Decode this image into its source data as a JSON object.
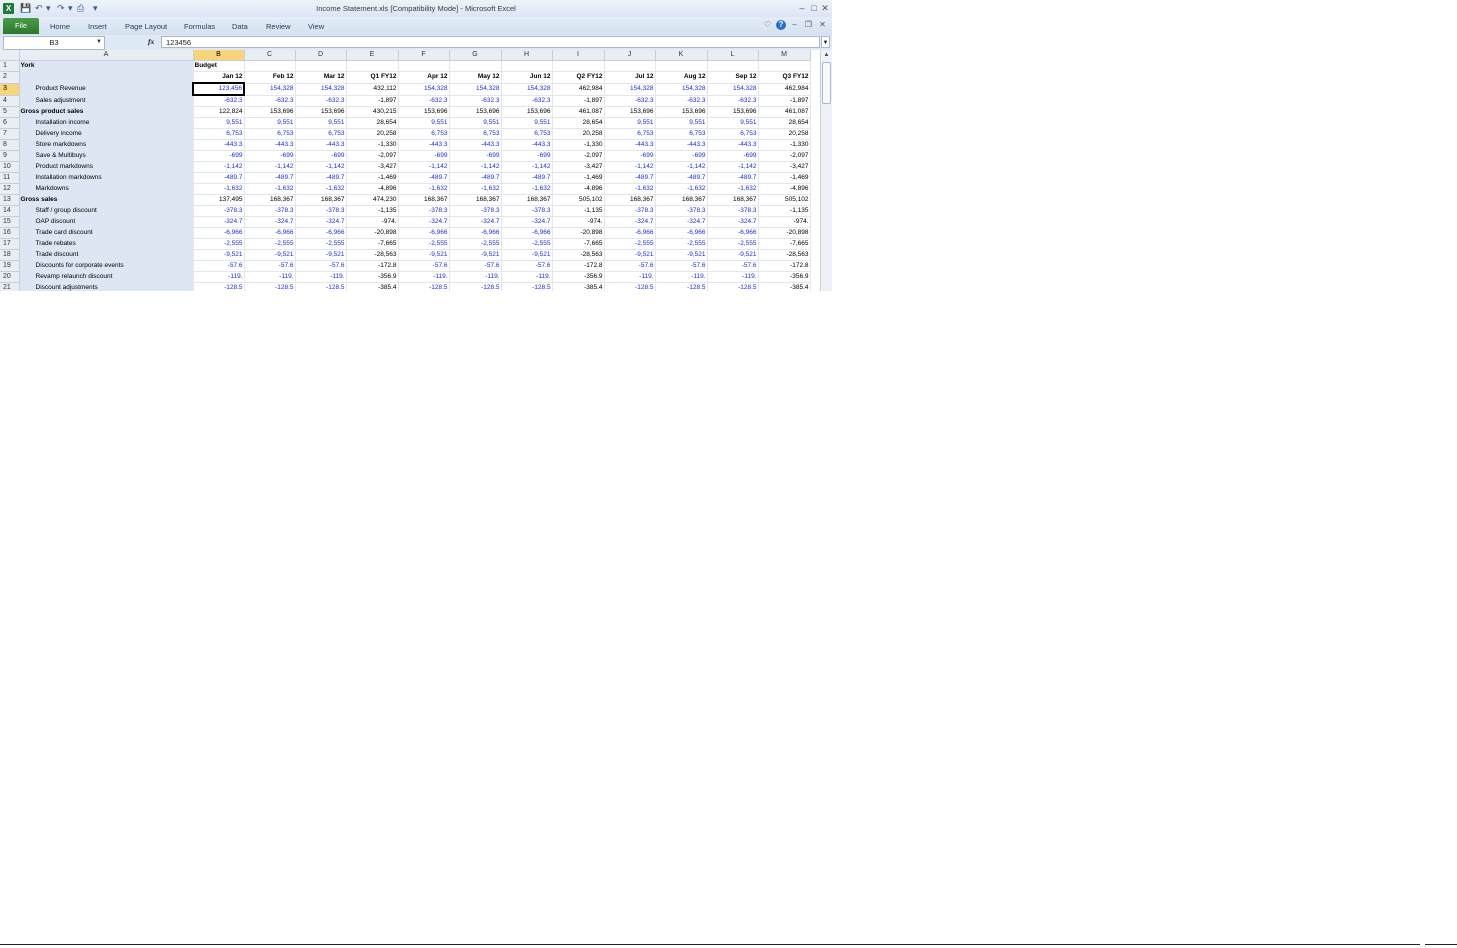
{
  "window": {
    "title": "Income Statement.xls  [Compatibility Mode]  -  Microsoft Excel",
    "app_icon": "excel-icon"
  },
  "ribbon": {
    "file_tab": "File",
    "tabs": [
      "Home",
      "Insert",
      "Page Layout",
      "Formulas",
      "Data",
      "Review",
      "View"
    ]
  },
  "formula_bar": {
    "name_box": "B3",
    "fx": "fx",
    "value": "123456"
  },
  "sheet": {
    "columns": [
      "A",
      "B",
      "C",
      "D",
      "E",
      "F",
      "G",
      "H",
      "I",
      "J",
      "K",
      "L",
      "M"
    ],
    "selected_column": "B",
    "rows": [
      {
        "n": "1",
        "label": "York",
        "style": "bold",
        "cells": [
          "Budget",
          "",
          "",
          "",
          "",
          "",
          "",
          "",
          "",
          "",
          "",
          ""
        ]
      },
      {
        "n": "2",
        "label": "",
        "style": "header",
        "cells": [
          "Jan 12",
          "Feb 12",
          "Mar 12",
          "Q1 FY12",
          "Apr 12",
          "May 12",
          "Jun 12",
          "Q2 FY12",
          "Jul 12",
          "Aug 12",
          "Sep 12",
          "Q3 FY12"
        ]
      },
      {
        "n": "3",
        "label": "Product Revenue",
        "style": "item",
        "cells": [
          "123,456",
          "154,328",
          "154,328",
          "432,112",
          "154,328",
          "154,328",
          "154,328",
          "462,984",
          "154,328",
          "154,328",
          "154,328",
          "462,984"
        ]
      },
      {
        "n": "4",
        "label": "Sales adjustment",
        "style": "item",
        "cells": [
          "-632.3",
          "-632.3",
          "-632.3",
          "-1,897",
          "-632.3",
          "-632.3",
          "-632.3",
          "-1,897",
          "-632.3",
          "-632.3",
          "-632.3",
          "-1,897"
        ]
      },
      {
        "n": "5",
        "label": "Gross product sales",
        "style": "total",
        "cells": [
          "122,824",
          "153,696",
          "153,696",
          "430,215",
          "153,696",
          "153,696",
          "153,696",
          "461,087",
          "153,696",
          "153,696",
          "153,696",
          "461,087"
        ]
      },
      {
        "n": "6",
        "label": "Installation income",
        "style": "item",
        "cells": [
          "9,551",
          "9,551",
          "9,551",
          "28,654",
          "9,551",
          "9,551",
          "9,551",
          "28,654",
          "9,551",
          "9,551",
          "9,551",
          "28,654"
        ]
      },
      {
        "n": "7",
        "label": "Delivery income",
        "style": "item",
        "cells": [
          "6,753",
          "6,753",
          "6,753",
          "20,258",
          "6,753",
          "6,753",
          "6,753",
          "20,258",
          "6,753",
          "6,753",
          "6,753",
          "20,258"
        ]
      },
      {
        "n": "8",
        "label": "Store markdowns",
        "style": "item",
        "cells": [
          "-443.3",
          "-443.3",
          "-443.3",
          "-1,330",
          "-443.3",
          "-443.3",
          "-443.3",
          "-1,330",
          "-443.3",
          "-443.3",
          "-443.3",
          "-1,330"
        ]
      },
      {
        "n": "9",
        "label": "Save & Multibuys",
        "style": "item",
        "cells": [
          "-699",
          "-699",
          "-699",
          "-2,097",
          "-699",
          "-699",
          "-699",
          "-2,097",
          "-699",
          "-699",
          "-699",
          "-2,097"
        ]
      },
      {
        "n": "10",
        "label": "Product markdowns",
        "style": "item",
        "cells": [
          "-1,142",
          "-1,142",
          "-1,142",
          "-3,427",
          "-1,142",
          "-1,142",
          "-1,142",
          "-3,427",
          "-1,142",
          "-1,142",
          "-1,142",
          "-3,427"
        ]
      },
      {
        "n": "11",
        "label": "Installation markdowns",
        "style": "item",
        "cells": [
          "-489.7",
          "-489.7",
          "-489.7",
          "-1,469",
          "-489.7",
          "-489.7",
          "-489.7",
          "-1,469",
          "-489.7",
          "-489.7",
          "-489.7",
          "-1,469"
        ]
      },
      {
        "n": "12",
        "label": "Markdowns",
        "style": "item",
        "cells": [
          "-1,632",
          "-1,632",
          "-1,632",
          "-4,896",
          "-1,632",
          "-1,632",
          "-1,632",
          "-4,896",
          "-1,632",
          "-1,632",
          "-1,632",
          "-4,896"
        ]
      },
      {
        "n": "13",
        "label": "Gross sales",
        "style": "total",
        "cells": [
          "137,495",
          "168,367",
          "168,367",
          "474,230",
          "168,367",
          "168,367",
          "168,367",
          "505,102",
          "168,367",
          "168,367",
          "168,367",
          "505,102"
        ]
      },
      {
        "n": "14",
        "label": "Staff / group discount",
        "style": "item",
        "cells": [
          "-378.3",
          "-378.3",
          "-378.3",
          "-1,135",
          "-378.3",
          "-378.3",
          "-378.3",
          "-1,135",
          "-378.3",
          "-378.3",
          "-378.3",
          "-1,135"
        ]
      },
      {
        "n": "15",
        "label": "OAP discount",
        "style": "item",
        "cells": [
          "-324.7",
          "-324.7",
          "-324.7",
          "-974.",
          "-324.7",
          "-324.7",
          "-324.7",
          "-974.",
          "-324.7",
          "-324.7",
          "-324.7",
          "-974."
        ]
      },
      {
        "n": "16",
        "label": "Trade card discount",
        "style": "item",
        "cells": [
          "-6,966",
          "-6,966",
          "-6,966",
          "-20,898",
          "-6,966",
          "-6,966",
          "-6,966",
          "-20,898",
          "-6,966",
          "-6,966",
          "-6,966",
          "-20,898"
        ]
      },
      {
        "n": "17",
        "label": "Trade rebates",
        "style": "item",
        "cells": [
          "-2,555",
          "-2,555",
          "-2,555",
          "-7,665",
          "-2,555",
          "-2,555",
          "-2,555",
          "-7,665",
          "-2,555",
          "-2,555",
          "-2,555",
          "-7,665"
        ]
      },
      {
        "n": "18",
        "label": "Trade discount",
        "style": "item",
        "cells": [
          "-9,521",
          "-9,521",
          "-9,521",
          "-28,563",
          "-9,521",
          "-9,521",
          "-9,521",
          "-28,563",
          "-9,521",
          "-9,521",
          "-9,521",
          "-28,563"
        ]
      },
      {
        "n": "19",
        "label": "Discounts for corporate events",
        "style": "item",
        "cells": [
          "-57.6",
          "-57.6",
          "-57.6",
          "-172.8",
          "-57.6",
          "-57.6",
          "-57.6",
          "-172.8",
          "-57.6",
          "-57.6",
          "-57.6",
          "-172.8"
        ]
      },
      {
        "n": "20",
        "label": "Revamp relaunch discount",
        "style": "item",
        "cells": [
          "-119.",
          "-119.",
          "-119.",
          "-356.9",
          "-119.",
          "-119.",
          "-119.",
          "-356.9",
          "-119.",
          "-119.",
          "-119.",
          "-356.9"
        ]
      },
      {
        "n": "21",
        "label": "Discount adjustments",
        "style": "item",
        "cells": [
          "-128.5",
          "-128.5",
          "-128.5",
          "-385.4",
          "-128.5",
          "-128.5",
          "-128.5",
          "-385.4",
          "-128.5",
          "-128.5",
          "-128.5",
          "-385.4"
        ]
      }
    ],
    "quarter_column_indices": [
      3,
      7,
      11
    ],
    "colors": {
      "input_blue": "#1c2fd6",
      "label_fill": "#dce6f4",
      "selected_header": "#f8d47a"
    }
  }
}
